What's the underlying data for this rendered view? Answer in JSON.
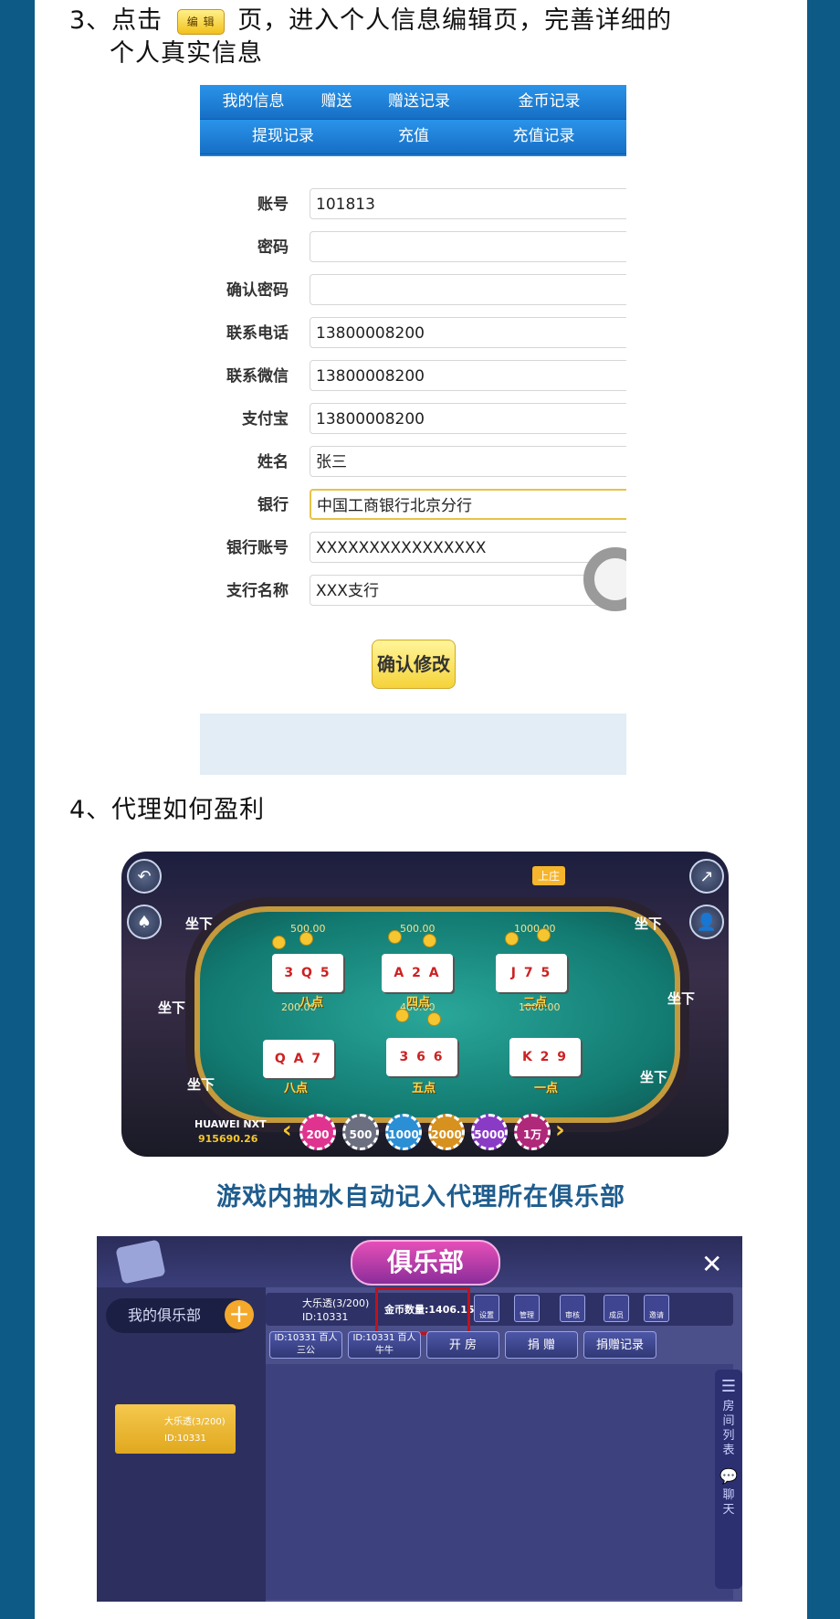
{
  "step3": {
    "prefix": "3、点击",
    "badge": "编 辑",
    "suffix_line1": "页，进入个人信息编辑页，完善详细的",
    "line2": "个人真实信息"
  },
  "form": {
    "tabs_row1": [
      "我的信息",
      "赠送",
      "赠送记录",
      "金币记录"
    ],
    "tabs_row2": [
      "提现记录",
      "充值",
      "充值记录"
    ],
    "fields": [
      {
        "label": "账号",
        "value": ""
      },
      {
        "label": "密码",
        "value": ""
      },
      {
        "label": "确认密码",
        "value": ""
      },
      {
        "label": "联系电话",
        "value": "13800008200"
      },
      {
        "label": "联系微信",
        "value": "13800008200"
      },
      {
        "label": "支付宝",
        "value": "13800008200"
      },
      {
        "label": "姓名",
        "value": "张三"
      },
      {
        "label": "银行",
        "value": "中国工商银行北京分行"
      },
      {
        "label": "银行账号",
        "value": "XXXXXXXXXXXXXXXX"
      },
      {
        "label": "支行名称",
        "value": "XXX支行"
      }
    ],
    "account_value": "101813",
    "confirm_label": "确认修改"
  },
  "step4": {
    "title": "4、代理如何盈利"
  },
  "game": {
    "seat_label": "坐下",
    "pots": [
      "500.00",
      "500.00",
      "1000.00",
      "200.00",
      "400.00",
      "1000.00"
    ],
    "hands": [
      "3 Q 5",
      "A 2 A",
      "J 7 5",
      "Q A 7",
      "3 6 6",
      "K 2 9"
    ],
    "results": [
      "八点",
      "四点",
      "二点",
      "八点",
      "五点",
      "一点"
    ],
    "player_name": "HUAWEI NXT",
    "player_coins": "915690.26",
    "chips": [
      "200",
      "500",
      "1000",
      "2000",
      "5000",
      "1万"
    ],
    "badge": "上庄"
  },
  "caption": "游戏内抽水自动记入代理所在俱乐部",
  "club": {
    "title": "俱乐部",
    "my_club": "我的俱乐部",
    "card_name": "大乐透(3/200)",
    "card_id": "ID:10331",
    "info_name": "大乐透(3/200)",
    "info_id": "ID:10331",
    "coins": "金币数量:1406.15",
    "icon_buttons": [
      "设置",
      "管理",
      "审核",
      "成员",
      "邀请"
    ],
    "actions": [
      "ID:10331 百人三公",
      "ID:10331 百人牛牛",
      "开 房",
      "捐 赠",
      "捐赠记录"
    ],
    "side_room_list": "房间列表",
    "side_chat": "聊天"
  }
}
